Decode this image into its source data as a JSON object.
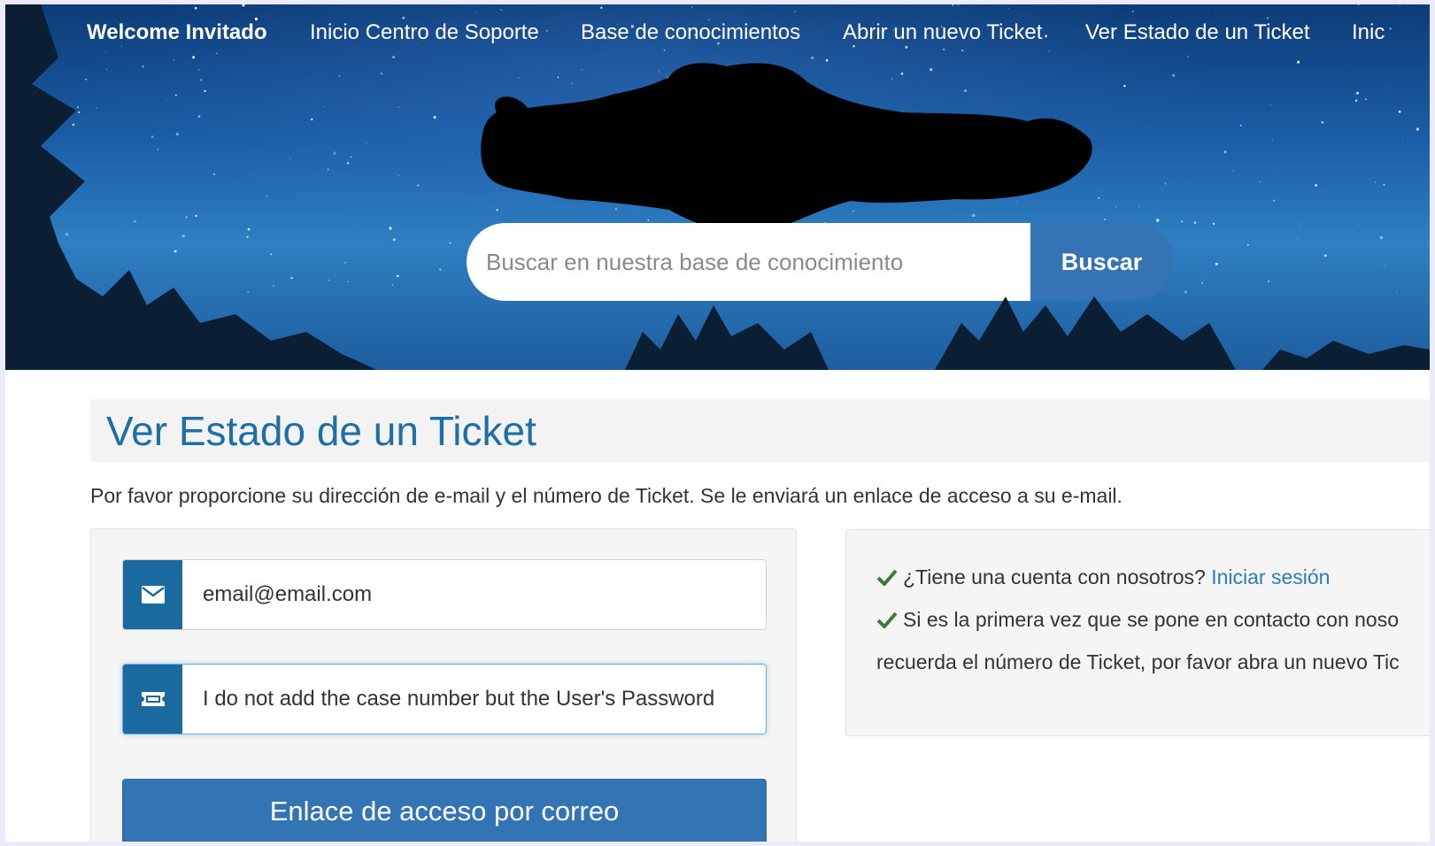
{
  "nav": {
    "welcome": "Welcome Invitado",
    "items": [
      "Inicio Centro de Soporte",
      "Base de conocimientos",
      "Abrir un nuevo Ticket",
      "Ver Estado de un Ticket",
      "Inic"
    ]
  },
  "search": {
    "placeholder": "Buscar en nuestra base de conocimiento",
    "button_label": "Buscar"
  },
  "page": {
    "title": "Ver Estado de un Ticket",
    "intro": "Por favor proporcione su dirección de e-mail y el número de Ticket. Se le enviará un enlace de acceso a su e-mail."
  },
  "form": {
    "email_value": "email@email.com",
    "ticket_value": "I do not add the case number but the User's Password",
    "submit_label": "Enlace de acceso por correo"
  },
  "info": {
    "account_question": "¿Tiene una cuenta con nosotros?",
    "login_link": "Iniciar sesión",
    "first_time_line1": "Si es la primera vez que se pone en contacto con noso",
    "first_time_line2": "recuerda el número de Ticket, por favor abra un nuevo Tic"
  },
  "icons": {
    "email": "envelope-icon",
    "ticket": "ticket-icon",
    "check": "check-icon"
  },
  "colors": {
    "accent": "#3274b4",
    "title": "#1d6fa5",
    "addon": "#1a6aa0",
    "check": "#3c7a3c",
    "link": "#2f7ab9"
  }
}
